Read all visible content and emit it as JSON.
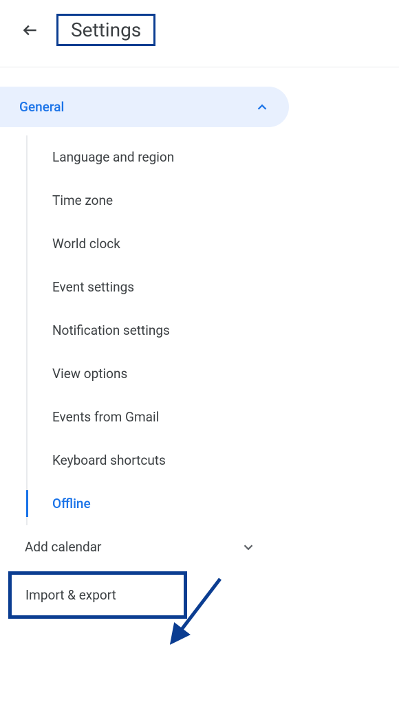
{
  "header": {
    "title": "Settings"
  },
  "sidebar": {
    "general": {
      "label": "General",
      "expanded": true,
      "items": [
        {
          "label": "Language and region",
          "active": false
        },
        {
          "label": "Time zone",
          "active": false
        },
        {
          "label": "World clock",
          "active": false
        },
        {
          "label": "Event settings",
          "active": false
        },
        {
          "label": "Notification settings",
          "active": false
        },
        {
          "label": "View options",
          "active": false
        },
        {
          "label": "Events from Gmail",
          "active": false
        },
        {
          "label": "Keyboard shortcuts",
          "active": false
        },
        {
          "label": "Offline",
          "active": true
        }
      ]
    },
    "addCalendar": {
      "label": "Add calendar",
      "expanded": false
    },
    "importExport": {
      "label": "Import & export"
    }
  },
  "annotations": {
    "titleHighlight": true,
    "importExportHighlight": true,
    "arrowColor": "#0b3d91"
  }
}
